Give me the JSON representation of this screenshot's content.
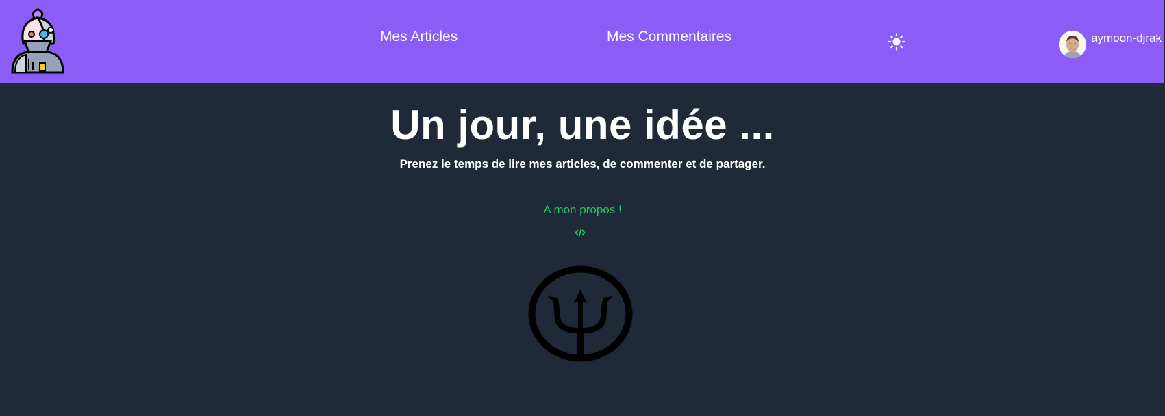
{
  "header": {
    "logo_icon": "cyborg-robot-logo",
    "nav": [
      {
        "label": "Mes Articles"
      },
      {
        "label": "Mes Commentaires"
      }
    ],
    "theme_icon": "sun-icon",
    "user": {
      "name": "aymoon-djrak",
      "avatar_icon": "user-avatar"
    }
  },
  "hero": {
    "title": "Un jour, une idée ...",
    "subtitle": "Prenez le temps de lire mes articles, de commenter et de partager.",
    "about_label": "A mon propos !",
    "code_icon": "code-icon",
    "emblem_icon": "trident-emblem"
  },
  "colors": {
    "header_bg": "#8b5cf6",
    "page_bg": "#1f2937",
    "accent_green": "#22c55e",
    "text": "#ffffff"
  }
}
